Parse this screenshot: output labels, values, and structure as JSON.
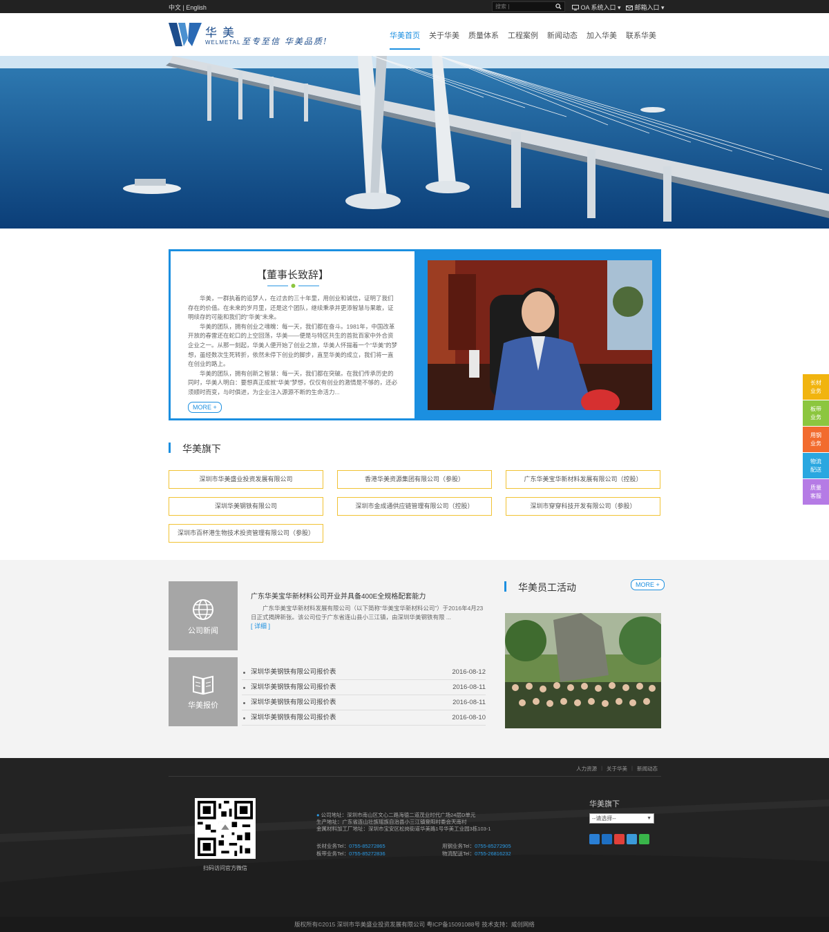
{
  "topbar": {
    "lang_cn": "中文",
    "lang_sep": "|",
    "lang_en": "English",
    "search_placeholder": "搜索 |",
    "oa_label": "OA 系统入口",
    "mail_label": "邮箱入口"
  },
  "header": {
    "brand_cn": "华美",
    "brand_en": "WELMETAL",
    "slogan": "至专至信 华美品质!",
    "nav": [
      "华美首页",
      "关于华美",
      "质量体系",
      "工程案例",
      "新闻动态",
      "加入华美",
      "联系华美"
    ],
    "active_index": 0
  },
  "chairman": {
    "title": "【董事长致辞】",
    "paragraphs": [
      "华美，一群执着的追梦人，在过去的三十年里，用创业和诚信，证明了我们存在的价值。在未来的岁月里，还是这个团队，继续秉承并更添智慧与果敢，证明续存的可能和我们的“华美”未来。",
      "华美的团队，拥有创业之魂魄：每一天，我们都在奋斗。1981年，中国改革开放的春雷还在蛇口的上空回荡，华美——便是与特区共生的首批百家中外合资企业之一。从那一刻起，华美人便开始了创业之旅，华美人怀揣着一个“华美”的梦想，虽经数次生死转折，依然未停下创业的脚步，直至华美的成立，我们将一直在创业的路上。",
      "华美的团队，拥有创新之智慧：每一天，我们都在突破。在我们传承历史的同时，华美人明白：要想真正成就“华美”梦想，仅仅有创业的激情是不够的，还必须顺时而变，与时俱进，为企业注入源源不断的生命活力..."
    ],
    "more_label": "MORE +"
  },
  "subsidiaries": {
    "title": "华美旗下",
    "items": [
      "深圳市华美盛业投资发展有限公司",
      "香港华美资源集团有限公司（参股）",
      "广东华美宝华新材料发展有限公司（控股）",
      "深圳华美钢铁有限公司",
      "深圳市金成通供应链管理有限公司（控股）",
      "深圳市穿穿科技开发有限公司（参股）",
      "深圳市百杯港生物技术投资管理有限公司（参股）"
    ]
  },
  "news": {
    "tile_label": "公司新闻",
    "headline": "广东华美宝华新材料公司开业并具备400E全规格配套能力",
    "body": "广东华美宝华新材料发展有限公司（以下简称“华美宝华新材料公司”）于2016年4月23日正式揭牌新张。该公司位于广东省连山县小三江镇，由深圳华美钢铁有限 ...",
    "detail_label": "[ 详细 ]"
  },
  "prices": {
    "tile_label": "华美报价",
    "rows": [
      {
        "title": "深圳华美钢铁有限公司报价表",
        "date": "2016-08-12"
      },
      {
        "title": "深圳华美钢铁有限公司报价表",
        "date": "2016-08-11"
      },
      {
        "title": "深圳华美钢铁有限公司报价表",
        "date": "2016-08-11"
      },
      {
        "title": "深圳华美钢铁有限公司报价表",
        "date": "2016-08-10"
      }
    ]
  },
  "activity": {
    "title": "华美员工活动",
    "more_label": "MORE +"
  },
  "footer": {
    "links": [
      "人力资源",
      "关于华美",
      "新闻动态"
    ],
    "qr_caption": "扫码访问官方微信",
    "addr1": "公司地址：深圳市南山区文心二路海德二道茂业时代广场24层D单元",
    "addr2": "生产地址：广东省连山壮族瑶族自治县小三江镇登阳村委会天南村",
    "addr3": "金属材料加工厂地址：深圳市宝安区松岗街道华美路1号华美工业园3栋103-1",
    "phone_long_label": "长材业务Tel：",
    "phone_long": "0755-85272865",
    "phone_plate_label": "板带业务Tel：",
    "phone_plate": "0755-85272836",
    "phone_steel_label": "用钢业务Tel：",
    "phone_steel": "0755-85272905",
    "phone_logi_label": "物流配送Tel：",
    "phone_logi": "0755-26816232",
    "sub_title": "华美旗下",
    "select_value": "--请选择--",
    "copyright": "版权所有©2015 深圳市华美盛业投资发展有限公司    粤ICP备15091088号    技术支持：威创网络"
  },
  "side_float": [
    {
      "line1": "长材",
      "line2": "业务",
      "color": "#f1b40f"
    },
    {
      "line1": "板带",
      "line2": "业务",
      "color": "#8cc63f"
    },
    {
      "line1": "用钢",
      "line2": "业务",
      "color": "#f26b2e"
    },
    {
      "line1": "物流",
      "line2": "配送",
      "color": "#2aa7e0"
    },
    {
      "line1": "质量",
      "line2": "客服",
      "color": "#b57be5"
    }
  ]
}
